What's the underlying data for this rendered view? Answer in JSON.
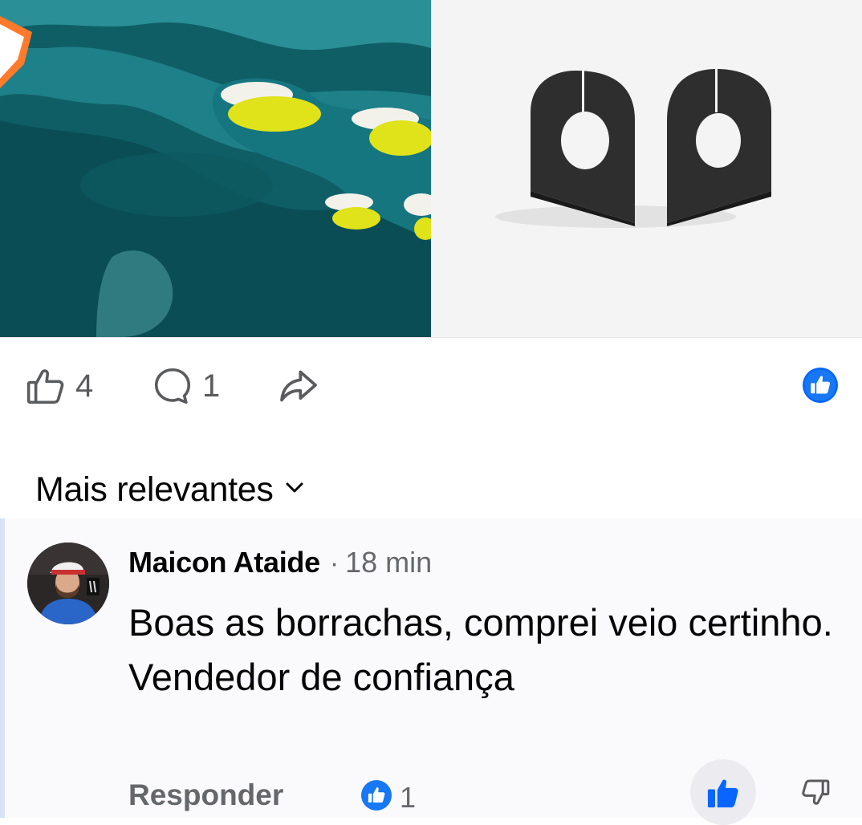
{
  "post": {
    "images": [
      {
        "name": "teal-plastic-part-photo"
      },
      {
        "name": "black-rubber-pieces-photo"
      }
    ],
    "actions": {
      "like_icon": "thumbs-up-outline-icon",
      "like_count": "4",
      "comment_icon": "comment-bubble-icon",
      "comment_count": "1",
      "share_icon": "share-arrow-icon",
      "reaction_icon": "like-reaction-badge-icon"
    }
  },
  "comments_section": {
    "sort_label": "Mais relevantes",
    "sort_icon": "chevron-down-icon"
  },
  "comments": [
    {
      "author": "Maicon Ataide",
      "separator": "·",
      "time": "18 min",
      "text": "Boas as borrachas, comprei veio certinho.\nVendedor de confiança",
      "reply_label": "Responder",
      "reaction_count": "1",
      "like_icon": "thumbs-up-filled-icon",
      "dislike_icon": "thumbs-down-icon"
    }
  ],
  "colors": {
    "accent_blue": "#0866ff",
    "muted_text": "#65676b",
    "thread_line": "#d8e2f6"
  }
}
